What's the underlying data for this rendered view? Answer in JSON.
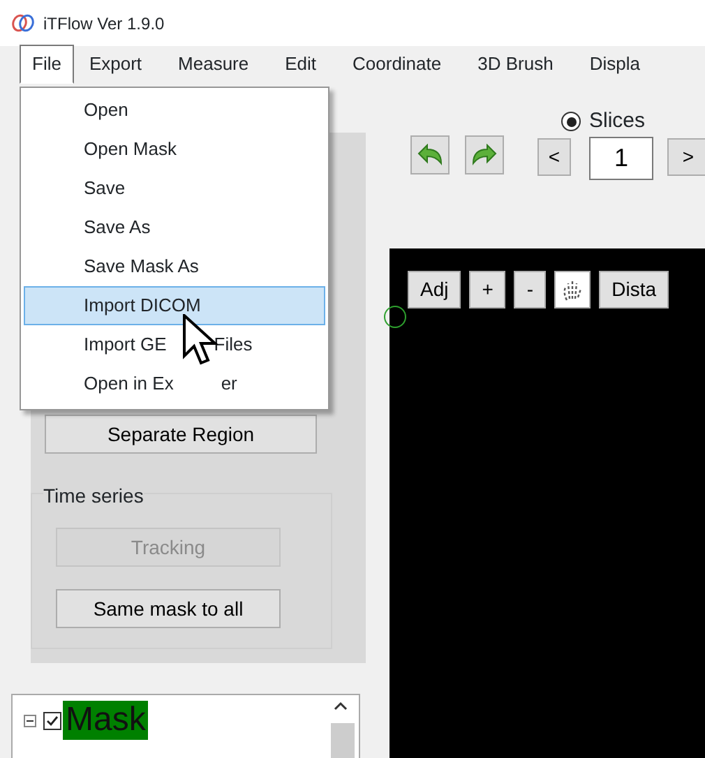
{
  "window": {
    "title": "iTFlow Ver 1.9.0"
  },
  "menu_bar": [
    {
      "label": "File",
      "selected": true
    },
    {
      "label": "Export",
      "selected": false
    },
    {
      "label": "Measure",
      "selected": false
    },
    {
      "label": "Edit",
      "selected": false
    },
    {
      "label": "Coordinate",
      "selected": false
    },
    {
      "label": "3D Brush",
      "selected": false
    },
    {
      "label": "Displa",
      "selected": false
    }
  ],
  "file_menu": [
    {
      "parts": [
        "Open"
      ],
      "selected": false
    },
    {
      "parts": [
        "Open Mask"
      ],
      "selected": false
    },
    {
      "parts": [
        "Save"
      ],
      "selected": false
    },
    {
      "parts": [
        "Save As"
      ],
      "selected": false
    },
    {
      "parts": [
        "Save Mask As"
      ],
      "selected": false
    },
    {
      "parts": [
        "Import DICOM"
      ],
      "selected": true
    },
    {
      "parts": [
        "Import GE",
        "Files"
      ],
      "selected": false
    },
    {
      "parts": [
        "Open in Ex",
        "er"
      ],
      "selected": false
    }
  ],
  "left_panel": {
    "separate_button": "Separate Region",
    "time_series": {
      "title": "Time series",
      "buttons": [
        {
          "label": "Tracking",
          "disabled": true
        },
        {
          "label": "Same mask to all",
          "disabled": false
        }
      ]
    }
  },
  "tree": {
    "items": [
      {
        "label": "Mask",
        "checked": true,
        "expanded": true
      }
    ]
  },
  "toolbar": {
    "slices_label": "Slices",
    "slices_selected": true,
    "prev": "<",
    "slice": "1",
    "next": ">"
  },
  "canvas_buttons": [
    "Adj",
    "+",
    "-",
    "Dista"
  ]
}
